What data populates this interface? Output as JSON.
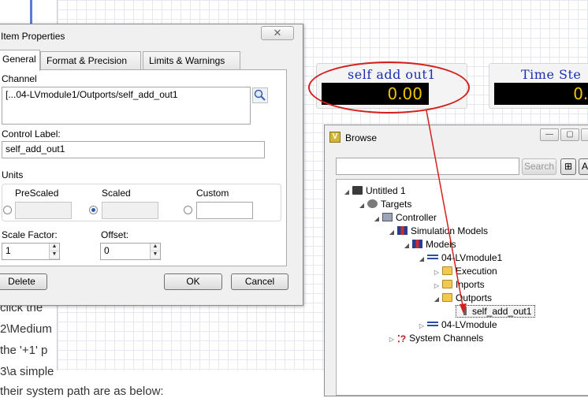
{
  "background": {
    "lines": [
      "click the",
      "2\\Medium",
      "the  '+1' p",
      "3\\a simple",
      "their system path are as below:"
    ]
  },
  "indicators": [
    {
      "label": "self add out1",
      "value": "0.00"
    },
    {
      "label": "Time Ste",
      "value": "0.0"
    }
  ],
  "dialog": {
    "title": "Item Properties",
    "close_glyph": "✕",
    "tabs": [
      "General",
      "Format & Precision",
      "Limits & Warnings"
    ],
    "channel_label": "Channel",
    "channel_value": "[...04-LVmodule1/Outports/self_add_out1",
    "control_label_label": "Control Label:",
    "control_label_value": "self_add_out1",
    "units_label": "Units",
    "unit_options": [
      "PreScaled",
      "Scaled",
      "Custom"
    ],
    "selected_unit": "Scaled",
    "scale_factor_label": "Scale Factor:",
    "scale_factor_value": "1",
    "offset_label": "Offset:",
    "offset_value": "0",
    "delete_label": "Delete",
    "ok_label": "OK",
    "cancel_label": "Cancel"
  },
  "browse": {
    "title": "Browse",
    "search_placeholder": "",
    "search_button": "Search",
    "tree": [
      {
        "label": "Untitled 1",
        "icon": "box-icon",
        "expander": "◢"
      },
      {
        "label": "Targets",
        "icon": "targets-icon",
        "expander": "◢"
      },
      {
        "label": "Controller",
        "icon": "controller-icon",
        "expander": "◢"
      },
      {
        "label": "Simulation Models",
        "icon": "models-icon",
        "expander": "◢"
      },
      {
        "label": "Models",
        "icon": "models-icon",
        "expander": "◢"
      },
      {
        "label": "04-LVmodule1",
        "icon": "module-icon",
        "expander": "◢"
      },
      {
        "label": "Execution",
        "icon": "folder-icon",
        "expander": "▷"
      },
      {
        "label": "Inports",
        "icon": "folder-icon",
        "expander": "▷"
      },
      {
        "label": "Outports",
        "icon": "folder-icon",
        "expander": "◢"
      },
      {
        "label": "self_add_out1",
        "icon": "port-icon",
        "expander": ""
      },
      {
        "label": "04-LVmodule",
        "icon": "module-icon",
        "expander": "▷"
      },
      {
        "label": "System Channels",
        "icon": "system-icon",
        "expander": "▷"
      }
    ]
  },
  "colors": {
    "indicator_text": "#f2c200",
    "indicator_label": "#1a2fb0",
    "annotation_red": "#d41f1f"
  }
}
